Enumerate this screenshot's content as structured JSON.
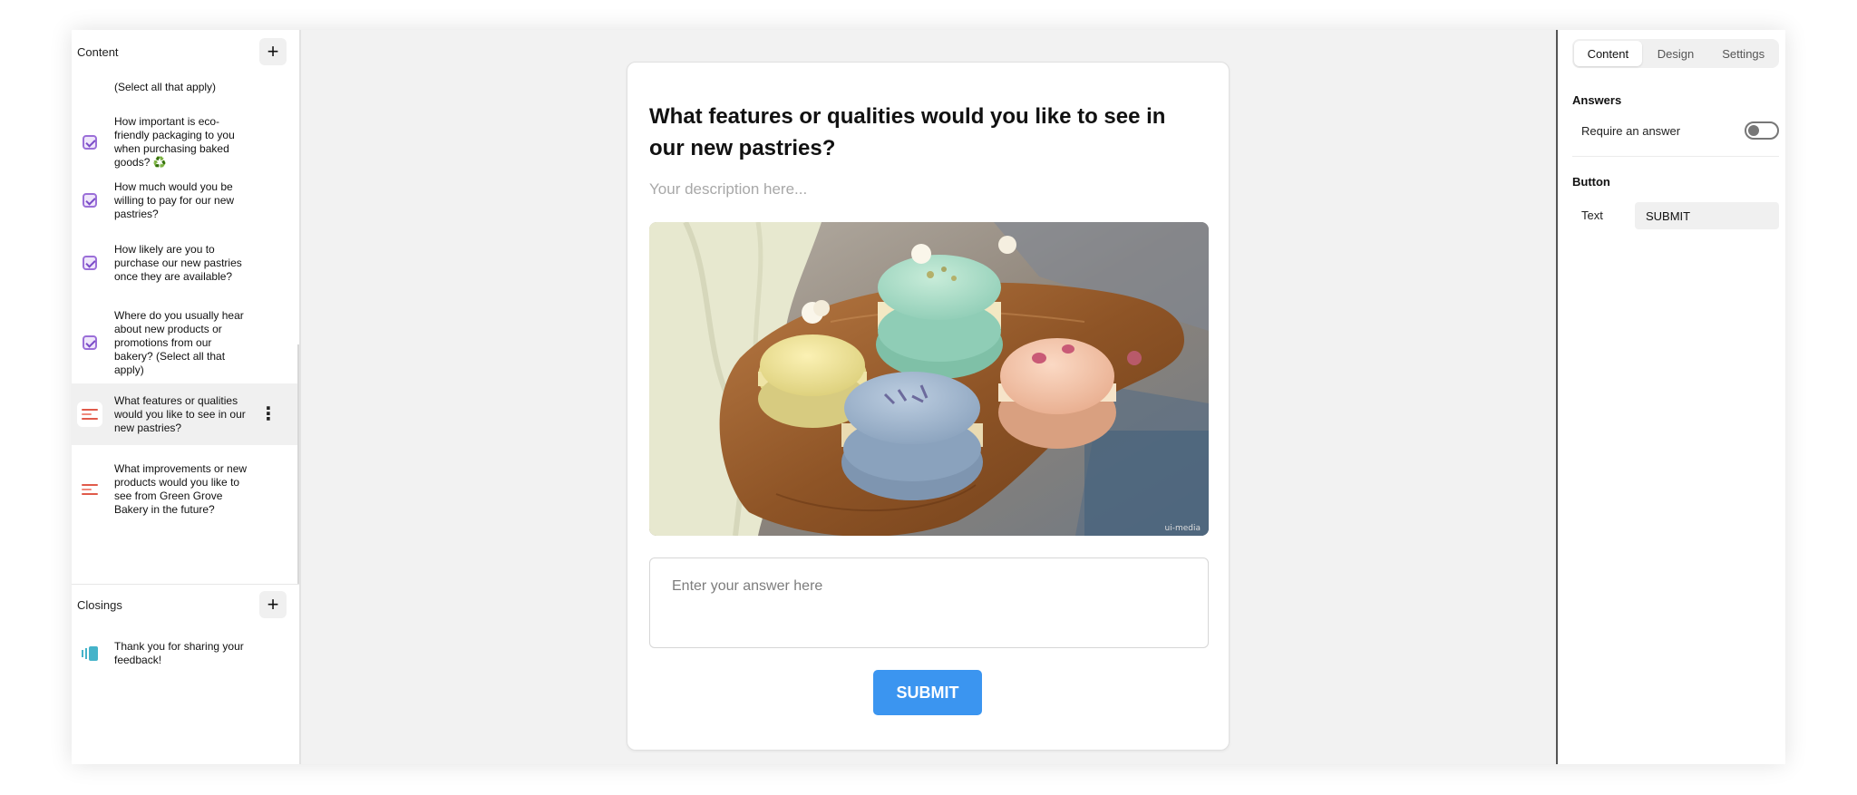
{
  "sidebar": {
    "content_title": "Content",
    "add_content_label": "+",
    "items": [
      {
        "label": "(Select all that apply)",
        "type": "checkbox"
      },
      {
        "label": "How important is eco-friendly packaging to you when purchasing baked goods? ♻️",
        "type": "checkbox"
      },
      {
        "label": "How much would you be willing to pay for our new pastries?",
        "type": "checkbox"
      },
      {
        "label": "How likely are you to purchase our new pastries once they are available?",
        "type": "checkbox"
      },
      {
        "label": "Where do you usually hear about new products or promotions from our bakery? (Select all that apply)",
        "type": "checkbox"
      },
      {
        "label": "What features or qualities would you like to see in our new pastries?",
        "type": "text",
        "active": true
      },
      {
        "label": "What improvements or new products would you like to see from Green Grove Bakery in the future?",
        "type": "text"
      }
    ],
    "kebab_label": "⋮",
    "closings_title": "Closings",
    "add_closing_label": "+",
    "closings": [
      {
        "label": "Thank you for sharing your feedback!"
      }
    ]
  },
  "card": {
    "question": "What features or qualities would you like to see in our new pastries?",
    "description_placeholder": "Your description here...",
    "image": {
      "subject": "macarons on wooden board",
      "credit": "ui-media"
    },
    "answer_placeholder": "Enter your answer here",
    "submit_label": "SUBMIT"
  },
  "panel": {
    "tabs": [
      "Content",
      "Design",
      "Settings"
    ],
    "active_tab": "Content",
    "answers_title": "Answers",
    "require_answer_label": "Require an answer",
    "require_answer": false,
    "button_title": "Button",
    "text_label": "Text",
    "text_value": "SUBMIT"
  },
  "colors": {
    "accent": "#3b95f0",
    "checkbox": "#9b6fd8",
    "text_question_icon": "#e05a4a",
    "ending_icon": "#45b3c9"
  }
}
